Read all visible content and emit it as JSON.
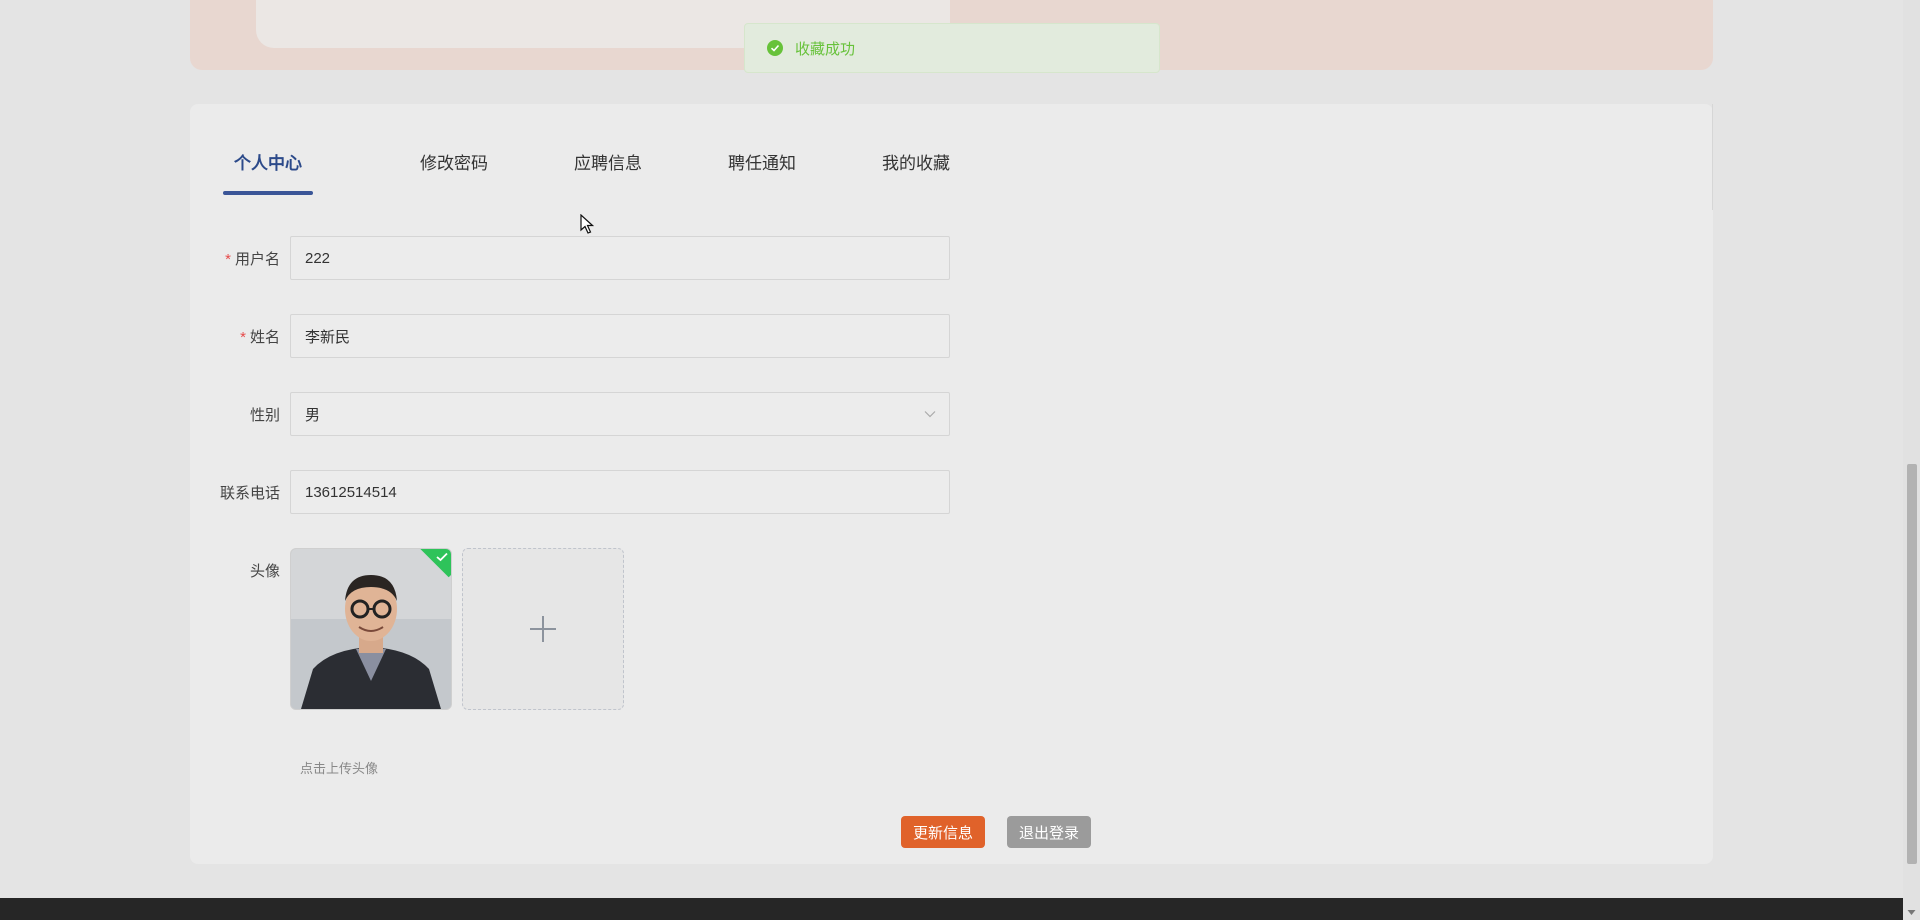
{
  "toast": {
    "message": "收藏成功",
    "color": "#67c23a"
  },
  "tabs": [
    {
      "label": "个人中心",
      "active": true
    },
    {
      "label": "修改密码",
      "active": false
    },
    {
      "label": "应聘信息",
      "active": false
    },
    {
      "label": "聘任通知",
      "active": false
    },
    {
      "label": "我的收藏",
      "active": false
    }
  ],
  "form": {
    "username": {
      "label": "用户名",
      "required": true,
      "value": "222"
    },
    "name": {
      "label": "姓名",
      "required": true,
      "value": "李新民"
    },
    "gender": {
      "label": "性别",
      "value": "男"
    },
    "phone": {
      "label": "联系电话",
      "value": "13612514514"
    },
    "avatar": {
      "label": "头像",
      "hint": "点击上传头像"
    }
  },
  "buttons": {
    "update": "更新信息",
    "logout": "退出登录"
  },
  "colors": {
    "accent": "#3a5597",
    "update_button": "#e0622a",
    "logout_button": "#9b9b9b"
  }
}
